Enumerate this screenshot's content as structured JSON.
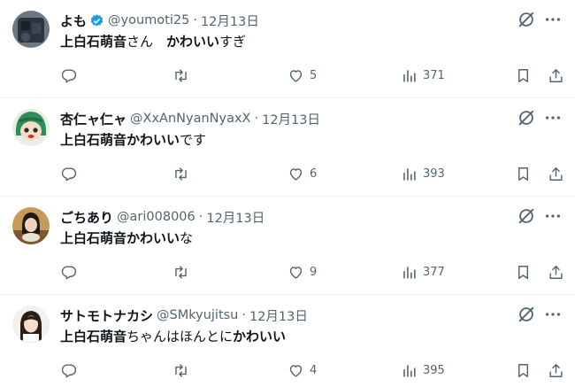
{
  "tweets": [
    {
      "name": "よも",
      "verified": true,
      "handle": "@youmoti25",
      "separator": "·",
      "date": "12月13日",
      "text": [
        {
          "bold": true,
          "t": "上白石萌音"
        },
        {
          "bold": false,
          "t": "さん　"
        },
        {
          "bold": true,
          "t": "かわいい"
        },
        {
          "bold": false,
          "t": "すぎ"
        }
      ],
      "stats": {
        "replies": "",
        "retweets": "",
        "likes": "5",
        "views": "371"
      }
    },
    {
      "name": "杏仁ャ仁ャ",
      "verified": false,
      "handle": "@XxAnNyanNyaxX",
      "separator": "·",
      "date": "12月13日",
      "text": [
        {
          "bold": true,
          "t": "上白石萌音かわいい"
        },
        {
          "bold": false,
          "t": "です"
        }
      ],
      "stats": {
        "replies": "",
        "retweets": "",
        "likes": "6",
        "views": "393"
      }
    },
    {
      "name": "ごちあり",
      "verified": false,
      "handle": "@ari008006",
      "separator": "·",
      "date": "12月13日",
      "text": [
        {
          "bold": true,
          "t": "上白石萌音かわいい"
        },
        {
          "bold": false,
          "t": "な"
        }
      ],
      "stats": {
        "replies": "",
        "retweets": "",
        "likes": "9",
        "views": "377"
      }
    },
    {
      "name": "サトモトナカシ",
      "verified": false,
      "handle": "@SMkyujitsu",
      "separator": "·",
      "date": "12月13日",
      "text": [
        {
          "bold": true,
          "t": "上白石萌音"
        },
        {
          "bold": false,
          "t": "ちゃんはほんとに"
        },
        {
          "bold": true,
          "t": "かわいい"
        }
      ],
      "stats": {
        "replies": "",
        "retweets": "",
        "likes": "4",
        "views": "395"
      }
    }
  ],
  "colors": {
    "text": "#0f1419",
    "muted": "#536471",
    "verified": "#1d9bf0",
    "divider": "#eff3f4"
  },
  "icons": [
    "reply-icon",
    "retweet-icon",
    "like-icon",
    "views-icon",
    "bookmark-icon",
    "share-icon",
    "grok-icon",
    "more-icon",
    "verified-badge-icon"
  ]
}
